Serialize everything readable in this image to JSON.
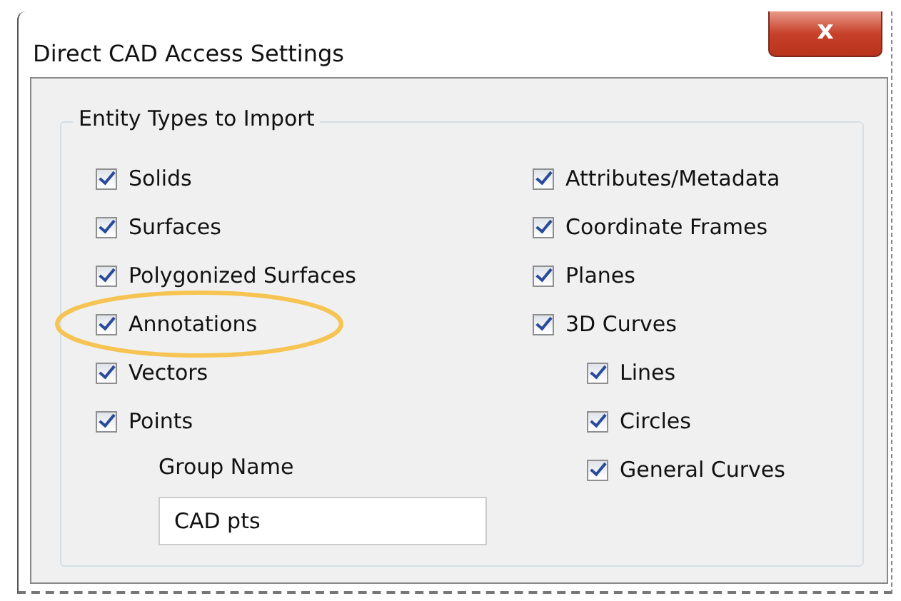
{
  "window": {
    "title": "Direct CAD Access Settings",
    "close": "x"
  },
  "group": {
    "title": "Entity Types to Import"
  },
  "left_items": [
    {
      "label": "Solids",
      "checked": true,
      "highlighted": false
    },
    {
      "label": "Surfaces",
      "checked": true,
      "highlighted": false
    },
    {
      "label": "Polygonized Surfaces",
      "checked": true,
      "highlighted": false
    },
    {
      "label": "Annotations",
      "checked": true,
      "highlighted": true
    },
    {
      "label": "Vectors",
      "checked": true,
      "highlighted": false
    },
    {
      "label": "Points",
      "checked": true,
      "highlighted": false
    }
  ],
  "group_name": {
    "label": "Group Name",
    "value": "CAD pts"
  },
  "right_items": [
    {
      "label": "Attributes/Metadata",
      "checked": true
    },
    {
      "label": "Coordinate Frames",
      "checked": true
    },
    {
      "label": "Planes",
      "checked": true
    },
    {
      "label": "3D Curves",
      "checked": true,
      "children": [
        {
          "label": "Lines",
          "checked": true
        },
        {
          "label": "Circles",
          "checked": true
        },
        {
          "label": "General Curves",
          "checked": true
        }
      ]
    }
  ]
}
